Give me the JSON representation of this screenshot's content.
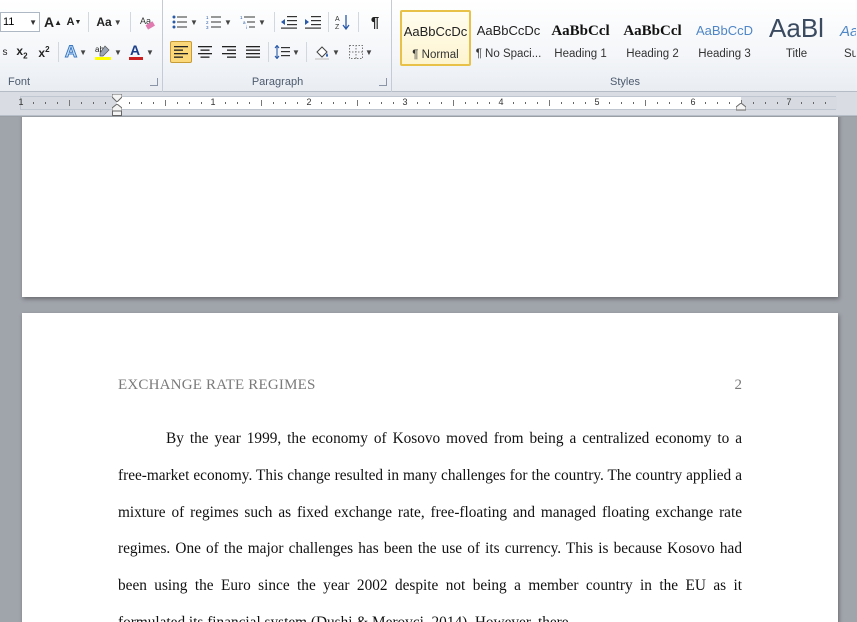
{
  "ribbon": {
    "font": {
      "label": "Font",
      "size": "11",
      "grow_label": "A",
      "shrink_label": "A",
      "case_label": "Aa",
      "text_color": "#cc1e1e",
      "highlight_color": "#ffff00"
    },
    "paragraph": {
      "label": "Paragraph",
      "show_marks": "¶"
    },
    "styles": {
      "label": "Styles",
      "items": [
        {
          "sample": "AaBbCcDc",
          "name": "¶ Normal",
          "active": true
        },
        {
          "sample": "AaBbCcDc",
          "name": "¶ No Spaci..."
        },
        {
          "sample": "AaBbCcl",
          "name": "Heading 1"
        },
        {
          "sample": "AaBbCcl",
          "name": "Heading 2"
        },
        {
          "sample": "AaBbCcD",
          "name": "Heading 3"
        },
        {
          "sample": "AaBl",
          "name": "Title"
        },
        {
          "sample": "Aa",
          "name": "Su"
        }
      ]
    }
  },
  "ruler": {
    "numbers": [
      "1",
      "1",
      "2",
      "3",
      "4",
      "5",
      "6",
      "7"
    ]
  },
  "document": {
    "page2": {
      "header_title": "EXCHANGE RATE REGIMES",
      "page_number": "2",
      "body": "By the year 1999, the economy of Kosovo moved from being a centralized economy to a free-market economy. This change resulted in many challenges for the country. The country applied a mixture of regimes such as fixed exchange rate, free-floating and managed floating exchange rate regimes. One of the major challenges has been the use of its currency. This is because Kosovo had been using the Euro since the year 2002 despite not being a member country in the EU as it formulated its financial system (Dushi & Merovci, 2014). However, there"
    }
  }
}
